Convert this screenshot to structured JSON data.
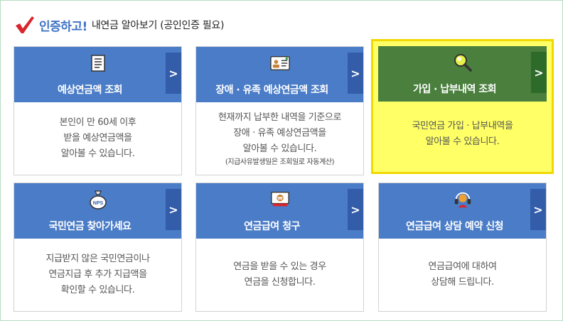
{
  "header": {
    "title_strong": "인증하고!",
    "title_rest": "내연금 알아보기 (공인인증 필요)"
  },
  "cards": [
    {
      "title": "예상연금액 조회",
      "lines": [
        "본인이 만 60세 이후",
        "받을 예상연금액을",
        "알아볼 수 있습니다."
      ],
      "note": "",
      "arrow": ">"
    },
    {
      "title": "장애 · 유족 예상연금액 조회",
      "lines": [
        "현재까지 납부한 내역을 기준으로",
        "장애 · 유족 예상연금액을",
        "알아볼 수 있습니다."
      ],
      "note": "(지급사유발생일은 조회일로 자동계산)",
      "arrow": ">"
    },
    {
      "title": "가입 · 납부내역 조회",
      "lines": [
        "국민연금 가입 · 납부내역을",
        "알아볼 수 있습니다."
      ],
      "note": "",
      "arrow": ">"
    },
    {
      "title": "국민연금 찾아가세요",
      "lines": [
        "지급받지 않은 국민연금이나",
        "연금지급 후 추가 지급액을",
        "확인할 수 있습니다."
      ],
      "note": "",
      "arrow": ">",
      "icon_text": "NPS"
    },
    {
      "title": "연금급여 청구",
      "lines": [
        "연금을 받을 수 있는 경우",
        "연금을 신청합니다."
      ],
      "note": "",
      "arrow": ">",
      "icon_text": "₩"
    },
    {
      "title": "연금급여 상담 예약 신청",
      "lines": [
        "연금급여에 대하여",
        "상담해 드립니다."
      ],
      "note": "",
      "arrow": ">"
    }
  ],
  "colors": {
    "card_blue": "#4a7cc7",
    "arrow_blue": "#335da8",
    "card_green": "#4a7f3e",
    "highlight_yellow": "#ffff66",
    "header_blue": "#3f73c6"
  }
}
